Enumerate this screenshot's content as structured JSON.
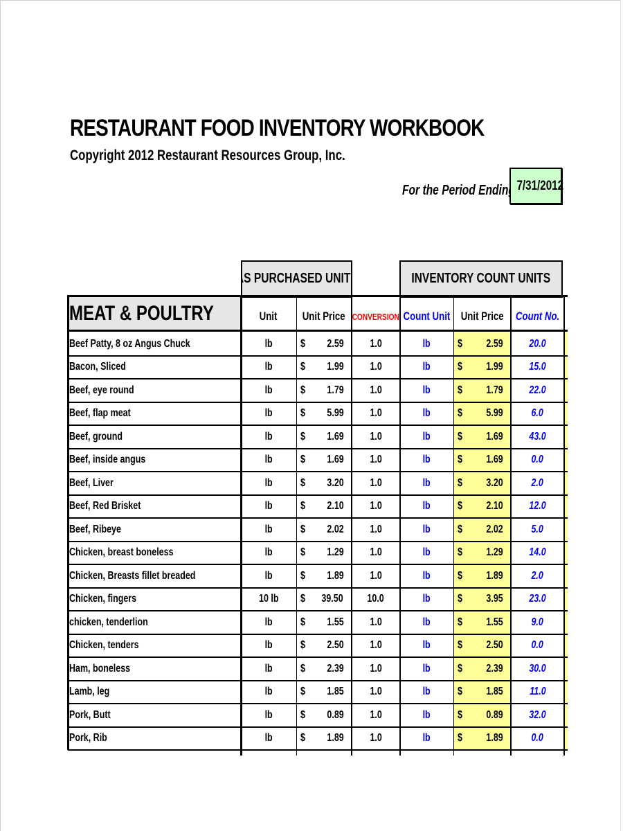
{
  "document": {
    "title": "RESTAURANT FOOD INVENTORY WORKBOOK",
    "copyright": "Copyright 2012 Restaurant Resources Group, Inc.",
    "period_label": "For the Period Ending",
    "period_date": "7/31/2012"
  },
  "table": {
    "group_headers": {
      "as_purchased": "AS PURCHASED UNITS",
      "inventory_count": "INVENTORY COUNT UNITS"
    },
    "category": "MEAT & POULTRY",
    "columns": {
      "unit": "Unit",
      "unit_price": "Unit Price",
      "conversion": "CONVERSION",
      "count_unit": "Count Unit",
      "count_unit_price": "Unit Price",
      "count_no": "Count No."
    },
    "currency_symbol": "$",
    "colors": {
      "header_gray": "#e6e6e6",
      "highlight_yellow": "#ffff99",
      "period_green": "#ccffcc",
      "conversion_red": "#ff0000",
      "input_blue": "#0000ff"
    },
    "rows": [
      {
        "item": "Beef Patty, 8 oz Angus Chuck",
        "unit": "lb",
        "price": "2.59",
        "conversion": "1.0",
        "count_unit": "lb",
        "count_price": "2.59",
        "count_no": "20.0"
      },
      {
        "item": "Bacon, Sliced",
        "unit": "lb",
        "price": "1.99",
        "conversion": "1.0",
        "count_unit": "lb",
        "count_price": "1.99",
        "count_no": "15.0"
      },
      {
        "item": "Beef, eye round",
        "unit": "lb",
        "price": "1.79",
        "conversion": "1.0",
        "count_unit": "lb",
        "count_price": "1.79",
        "count_no": "22.0"
      },
      {
        "item": "Beef, flap meat",
        "unit": "lb",
        "price": "5.99",
        "conversion": "1.0",
        "count_unit": "lb",
        "count_price": "5.99",
        "count_no": "6.0"
      },
      {
        "item": "Beef, ground",
        "unit": "lb",
        "price": "1.69",
        "conversion": "1.0",
        "count_unit": "lb",
        "count_price": "1.69",
        "count_no": "43.0"
      },
      {
        "item": "Beef, inside angus",
        "unit": "lb",
        "price": "1.69",
        "conversion": "1.0",
        "count_unit": "lb",
        "count_price": "1.69",
        "count_no": "0.0"
      },
      {
        "item": "Beef, Liver",
        "unit": "lb",
        "price": "3.20",
        "conversion": "1.0",
        "count_unit": "lb",
        "count_price": "3.20",
        "count_no": "2.0"
      },
      {
        "item": "Beef, Red Brisket",
        "unit": "lb",
        "price": "2.10",
        "conversion": "1.0",
        "count_unit": "lb",
        "count_price": "2.10",
        "count_no": "12.0"
      },
      {
        "item": "Beef, Ribeye",
        "unit": "lb",
        "price": "2.02",
        "conversion": "1.0",
        "count_unit": "lb",
        "count_price": "2.02",
        "count_no": "5.0"
      },
      {
        "item": "Chicken, breast boneless",
        "unit": "lb",
        "price": "1.29",
        "conversion": "1.0",
        "count_unit": "lb",
        "count_price": "1.29",
        "count_no": "14.0"
      },
      {
        "item": "Chicken, Breasts fillet breaded",
        "unit": "lb",
        "price": "1.89",
        "conversion": "1.0",
        "count_unit": "lb",
        "count_price": "1.89",
        "count_no": "2.0"
      },
      {
        "item": "Chicken, fingers",
        "unit": "10 lb",
        "price": "39.50",
        "conversion": "10.0",
        "count_unit": "lb",
        "count_price": "3.95",
        "count_no": "23.0"
      },
      {
        "item": "chicken, tenderlion",
        "unit": "lb",
        "price": "1.55",
        "conversion": "1.0",
        "count_unit": "lb",
        "count_price": "1.55",
        "count_no": "9.0"
      },
      {
        "item": "Chicken, tenders",
        "unit": "lb",
        "price": "2.50",
        "conversion": "1.0",
        "count_unit": "lb",
        "count_price": "2.50",
        "count_no": "0.0"
      },
      {
        "item": "Ham, boneless",
        "unit": "lb",
        "price": "2.39",
        "conversion": "1.0",
        "count_unit": "lb",
        "count_price": "2.39",
        "count_no": "30.0"
      },
      {
        "item": "Lamb, leg",
        "unit": "lb",
        "price": "1.85",
        "conversion": "1.0",
        "count_unit": "lb",
        "count_price": "1.85",
        "count_no": "11.0"
      },
      {
        "item": "Pork, Butt",
        "unit": "lb",
        "price": "0.89",
        "conversion": "1.0",
        "count_unit": "lb",
        "count_price": "0.89",
        "count_no": "32.0"
      },
      {
        "item": "Pork, Rib",
        "unit": "lb",
        "price": "1.89",
        "conversion": "1.0",
        "count_unit": "lb",
        "count_price": "1.89",
        "count_no": "0.0"
      }
    ]
  }
}
